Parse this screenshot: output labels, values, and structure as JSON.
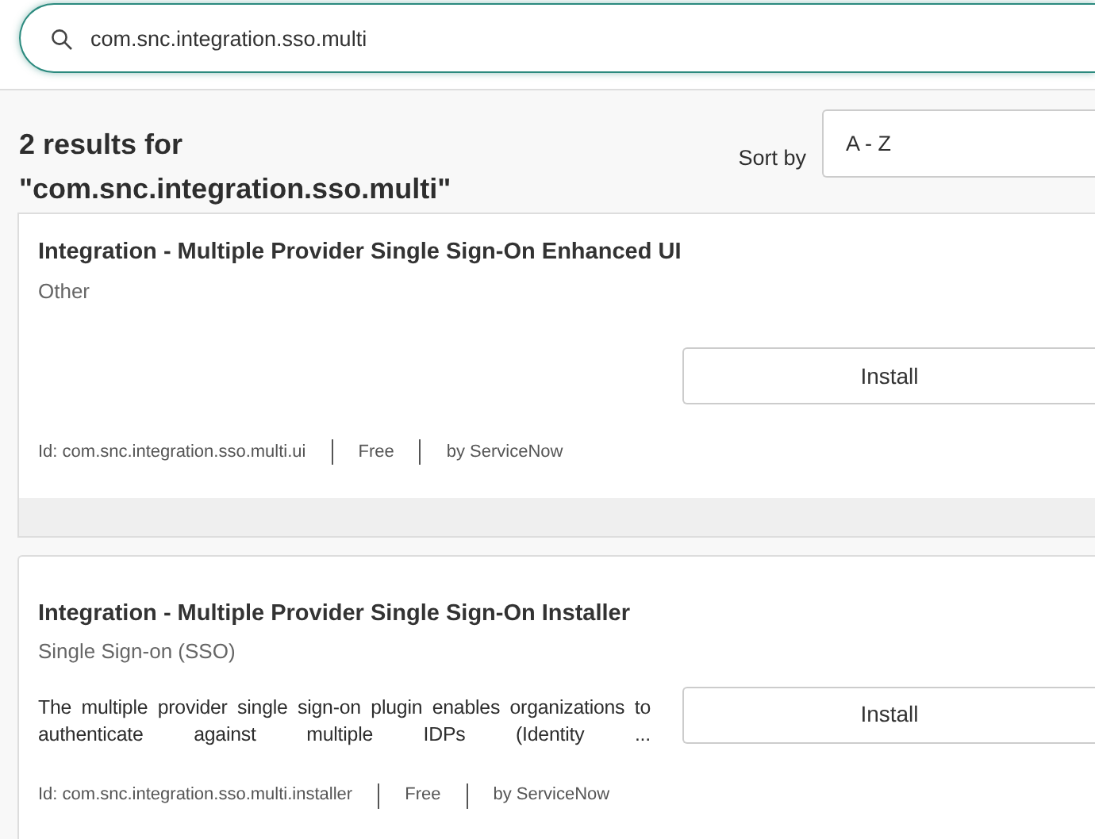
{
  "search": {
    "value": "com.snc.integration.sso.multi"
  },
  "results_heading": "2 results for \"com.snc.integration.sso.multi\"",
  "sort": {
    "label": "Sort by",
    "value": "A - Z"
  },
  "results": [
    {
      "title": "Integration - Multiple Provider Single Sign-On Enhanced UI",
      "category": "Other",
      "button": "Install",
      "meta": [
        "Id: com.snc.integration.sso.multi.ui",
        "Free",
        "by ServiceNow"
      ]
    },
    {
      "title": "Integration - Multiple Provider Single Sign-On Installer",
      "category": "Single Sign-on (SSO)",
      "description": "The multiple provider single sign-on plugin enables organizations to authenticate against multiple IDPs (Identity ...",
      "button": "Install",
      "meta": [
        "Id: com.snc.integration.sso.multi.installer",
        "Free",
        "by ServiceNow"
      ]
    }
  ]
}
